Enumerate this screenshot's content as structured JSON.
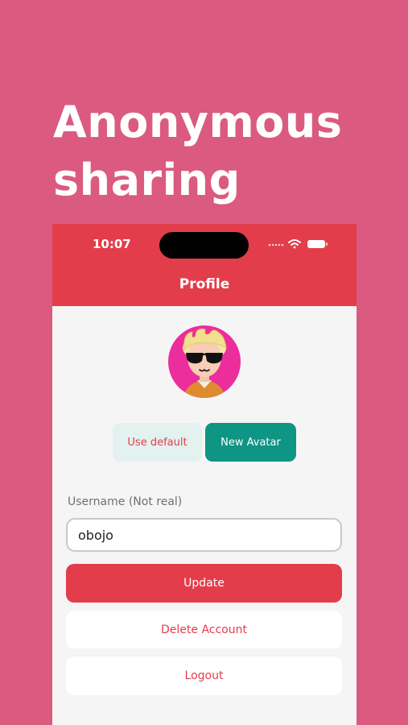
{
  "headline": {
    "line1": "Anonymous",
    "line2": "sharing"
  },
  "status_bar": {
    "time": "10:07",
    "icons": [
      "signal-dots-icon",
      "wifi-icon",
      "battery-icon"
    ]
  },
  "nav": {
    "title": "Profile"
  },
  "avatar": {
    "icon": "avatar-sunglasses-icon"
  },
  "avatar_actions": {
    "use_default_label": "Use default",
    "new_avatar_label": "New Avatar"
  },
  "form": {
    "username_label": "Username (Not real)",
    "username_value": "obojo"
  },
  "actions": {
    "update_label": "Update",
    "delete_label": "Delete Account",
    "logout_label": "Logout"
  },
  "colors": {
    "background": "#db5a80",
    "header": "#e33d4b",
    "primary_button": "#e33d4b",
    "accent_button": "#0e9584",
    "secondary_button": "#e3f1ef",
    "screen": "#f5f5f5"
  }
}
